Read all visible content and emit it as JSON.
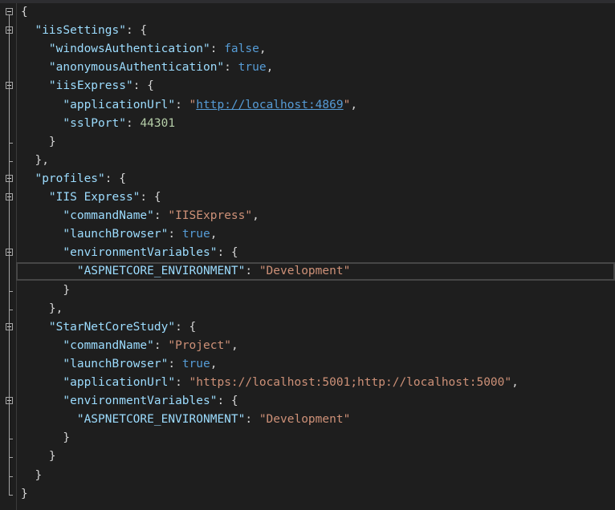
{
  "lines": [
    {
      "tokens": [
        [
          "p",
          "{"
        ]
      ]
    },
    {
      "tokens": [
        [
          "p",
          "  "
        ],
        [
          "k",
          "\"iisSettings\""
        ],
        [
          "p",
          ": {"
        ]
      ]
    },
    {
      "tokens": [
        [
          "p",
          "    "
        ],
        [
          "k",
          "\"windowsAuthentication\""
        ],
        [
          "p",
          ": "
        ],
        [
          "b",
          "false"
        ],
        [
          "p",
          ","
        ]
      ]
    },
    {
      "tokens": [
        [
          "p",
          "    "
        ],
        [
          "k",
          "\"anonymousAuthentication\""
        ],
        [
          "p",
          ": "
        ],
        [
          "b",
          "true"
        ],
        [
          "p",
          ","
        ]
      ]
    },
    {
      "tokens": [
        [
          "p",
          "    "
        ],
        [
          "k",
          "\"iisExpress\""
        ],
        [
          "p",
          ": {"
        ]
      ]
    },
    {
      "tokens": [
        [
          "p",
          "      "
        ],
        [
          "k",
          "\"applicationUrl\""
        ],
        [
          "p",
          ": "
        ],
        [
          "s",
          "\""
        ],
        [
          "u",
          "http://localhost:4869"
        ],
        [
          "s",
          "\""
        ],
        [
          "p",
          ","
        ]
      ]
    },
    {
      "tokens": [
        [
          "p",
          "      "
        ],
        [
          "k",
          "\"sslPort\""
        ],
        [
          "p",
          ": "
        ],
        [
          "n",
          "44301"
        ]
      ]
    },
    {
      "tokens": [
        [
          "p",
          "    }"
        ]
      ]
    },
    {
      "tokens": [
        [
          "p",
          "  },"
        ]
      ]
    },
    {
      "tokens": [
        [
          "p",
          "  "
        ],
        [
          "k",
          "\"profiles\""
        ],
        [
          "p",
          ": {"
        ]
      ]
    },
    {
      "tokens": [
        [
          "p",
          "    "
        ],
        [
          "k",
          "\"IIS Express\""
        ],
        [
          "p",
          ": {"
        ]
      ]
    },
    {
      "tokens": [
        [
          "p",
          "      "
        ],
        [
          "k",
          "\"commandName\""
        ],
        [
          "p",
          ": "
        ],
        [
          "s",
          "\"IISExpress\""
        ],
        [
          "p",
          ","
        ]
      ]
    },
    {
      "tokens": [
        [
          "p",
          "      "
        ],
        [
          "k",
          "\"launchBrowser\""
        ],
        [
          "p",
          ": "
        ],
        [
          "b",
          "true"
        ],
        [
          "p",
          ","
        ]
      ]
    },
    {
      "tokens": [
        [
          "p",
          "      "
        ],
        [
          "k",
          "\"environmentVariables\""
        ],
        [
          "p",
          ": {"
        ]
      ]
    },
    {
      "tokens": [
        [
          "p",
          "        "
        ],
        [
          "k",
          "\"ASPNETCORE_ENVIRONMENT\""
        ],
        [
          "p",
          ": "
        ],
        [
          "s",
          "\"Development\""
        ]
      ]
    },
    {
      "tokens": [
        [
          "p",
          "      }"
        ]
      ]
    },
    {
      "tokens": [
        [
          "p",
          "    },"
        ]
      ]
    },
    {
      "tokens": [
        [
          "p",
          "    "
        ],
        [
          "k",
          "\"StarNetCoreStudy\""
        ],
        [
          "p",
          ": {"
        ]
      ]
    },
    {
      "tokens": [
        [
          "p",
          "      "
        ],
        [
          "k",
          "\"commandName\""
        ],
        [
          "p",
          ": "
        ],
        [
          "s",
          "\"Project\""
        ],
        [
          "p",
          ","
        ]
      ]
    },
    {
      "tokens": [
        [
          "p",
          "      "
        ],
        [
          "k",
          "\"launchBrowser\""
        ],
        [
          "p",
          ": "
        ],
        [
          "b",
          "true"
        ],
        [
          "p",
          ","
        ]
      ]
    },
    {
      "tokens": [
        [
          "p",
          "      "
        ],
        [
          "k",
          "\"applicationUrl\""
        ],
        [
          "p",
          ": "
        ],
        [
          "s",
          "\"https://localhost:5001;http://localhost:5000\""
        ],
        [
          "p",
          ","
        ]
      ]
    },
    {
      "tokens": [
        [
          "p",
          "      "
        ],
        [
          "k",
          "\"environmentVariables\""
        ],
        [
          "p",
          ": {"
        ]
      ]
    },
    {
      "tokens": [
        [
          "p",
          "        "
        ],
        [
          "k",
          "\"ASPNETCORE_ENVIRONMENT\""
        ],
        [
          "p",
          ": "
        ],
        [
          "s",
          "\"Development\""
        ]
      ]
    },
    {
      "tokens": [
        [
          "p",
          "      }"
        ]
      ]
    },
    {
      "tokens": [
        [
          "p",
          "    }"
        ]
      ]
    },
    {
      "tokens": [
        [
          "p",
          "  }"
        ]
      ]
    },
    {
      "tokens": [
        [
          "p",
          "}"
        ]
      ]
    }
  ],
  "current_line": 14,
  "fold_markers": [
    0,
    1,
    4,
    9,
    10,
    13,
    17,
    21
  ],
  "colors": {
    "background": "#1e1e1e",
    "property": "#9cdcfe",
    "string": "#ce9178",
    "keyword": "#569cd6",
    "number": "#b5cea8",
    "punctuation": "#d4d4d4"
  }
}
